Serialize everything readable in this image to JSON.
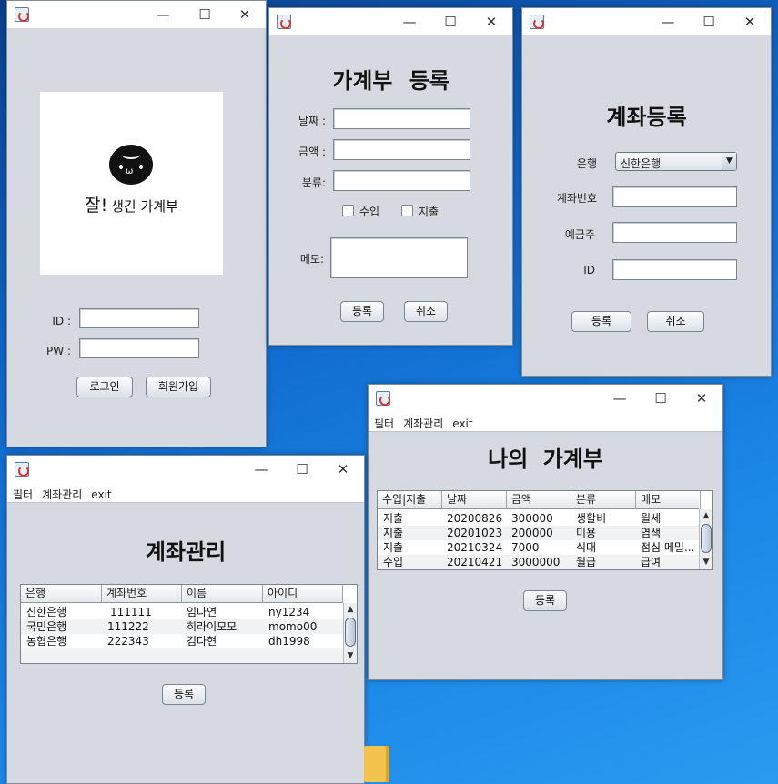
{
  "login": {
    "logo_text_big": "잘!",
    "logo_text_small": "생긴 가계부",
    "logo_face": "ω",
    "id_label": "ID :",
    "pw_label": "PW :",
    "login_button": "로그인",
    "signup_button": "회원가입"
  },
  "ledger_form": {
    "title": "가계부 등록",
    "date_label": "날짜 :",
    "amount_label": "금액 :",
    "category_label": "분류:",
    "income_label": "수입",
    "expense_label": "지출",
    "memo_label": "메모:",
    "register_button": "등록",
    "cancel_button": "취소"
  },
  "account_form": {
    "title": "계좌등록",
    "bank_label": "은행",
    "bank_selected": "신한은행",
    "account_no_label": "계좌번호",
    "holder_label": "예금주",
    "id_label": "ID",
    "register_button": "등록",
    "cancel_button": "취소"
  },
  "my_ledger": {
    "menu": [
      "필터",
      "계좌관리",
      "exit"
    ],
    "title": "나의 가계부",
    "columns": [
      "수입|지출",
      "날짜",
      "금액",
      "분류",
      "메모"
    ],
    "rows": [
      [
        "지출",
        "20200826",
        "300000",
        "생활비",
        "월세"
      ],
      [
        "지출",
        "20201023",
        "200000",
        "미용",
        "염색"
      ],
      [
        "지출",
        "20210324",
        "7000",
        "식대",
        "점심 메밀..."
      ],
      [
        "수입",
        "20210421",
        "3000000",
        "월급",
        "급여"
      ]
    ],
    "register_button": "등록"
  },
  "account_mgmt": {
    "menu": [
      "필터",
      "계좌관리",
      "exit"
    ],
    "title": "계좌관리",
    "columns": [
      "은행",
      "계좌번호",
      "이름",
      "아이디"
    ],
    "rows": [
      [
        "신한은행",
        "111111",
        "임나연",
        "ny1234"
      ],
      [
        "국민은행",
        "111222",
        "히라이모모",
        "momo00"
      ],
      [
        "농협은행",
        "222343",
        "김다현",
        "dh1998"
      ]
    ],
    "register_button": "등록"
  },
  "window_controls": {
    "minimize": "—",
    "maximize": "☐",
    "close": "✕"
  },
  "scroll": {
    "up": "▲",
    "down": "▼",
    "combo_arrow": "▼"
  }
}
